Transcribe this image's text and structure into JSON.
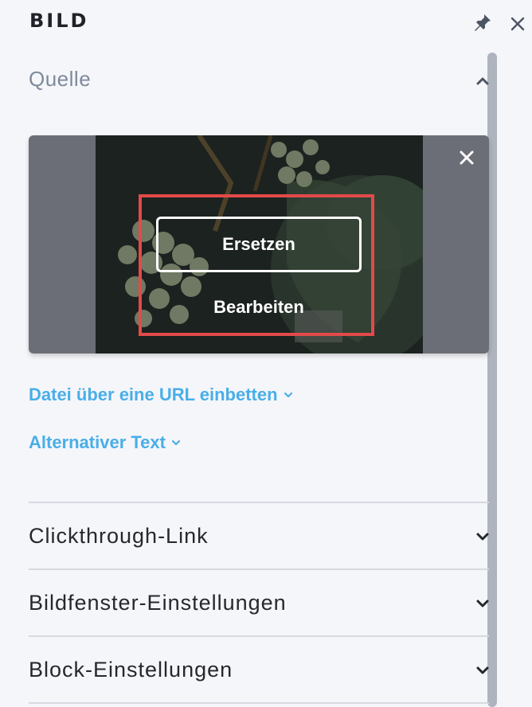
{
  "panel": {
    "title": "BILD"
  },
  "source_section": {
    "label": "Quelle",
    "expanded": true
  },
  "image_card": {
    "replace_label": "Ersetzen",
    "edit_label": "Bearbeiten",
    "highlight_color": "#e24a4a"
  },
  "links": {
    "embed_url": "Datei über eine URL einbetten",
    "alt_text": "Alternativer Text",
    "color": "#49aee8"
  },
  "accordions": [
    {
      "label": "Clickthrough-Link"
    },
    {
      "label": "Bildfenster-Einstellungen"
    },
    {
      "label": "Block-Einstellungen"
    }
  ],
  "icons": {
    "pin": "pin-icon",
    "close": "close-icon",
    "collapse": "chevron-up-icon",
    "expand": "chevron-down-icon",
    "remove": "close-icon"
  }
}
